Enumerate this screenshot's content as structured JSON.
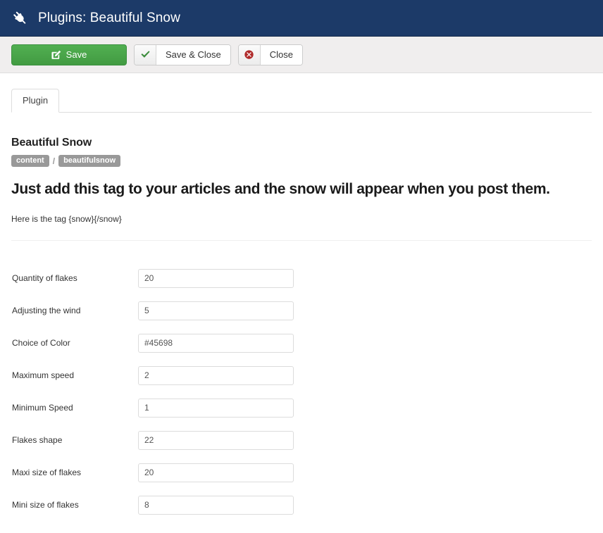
{
  "header": {
    "icon": "plug-icon",
    "title": "Plugins: Beautiful Snow",
    "bg_color": "#1c3a68"
  },
  "toolbar": {
    "save": {
      "label": "Save",
      "icon": "edit-pencil-square-icon",
      "color": "#46a546"
    },
    "save_close": {
      "label": "Save & Close",
      "icon": "check-icon",
      "color": "#3c9140"
    },
    "close": {
      "label": "Close",
      "icon": "close-circle-icon",
      "color": "#b02b2b"
    }
  },
  "tabs": [
    {
      "label": "Plugin",
      "active": true
    }
  ],
  "plugin": {
    "title": "Beautiful Snow",
    "badges": [
      "content",
      "beautifulsnow"
    ],
    "badge_separator": "/",
    "tagline": "Just add this tag to your articles and the snow will appear when you post them.",
    "note": "Here is the tag {snow}{/snow}"
  },
  "fields": [
    {
      "label": "Quantity of flakes",
      "value": "20"
    },
    {
      "label": "Adjusting the wind",
      "value": "5"
    },
    {
      "label": "Choice of Color",
      "value": "#45698"
    },
    {
      "label": "Maximum speed",
      "value": "2"
    },
    {
      "label": "Minimum Speed",
      "value": "1"
    },
    {
      "label": "Flakes shape",
      "value": "22"
    },
    {
      "label": "Maxi size of flakes",
      "value": "20"
    },
    {
      "label": "Mini size of flakes",
      "value": "8"
    }
  ]
}
